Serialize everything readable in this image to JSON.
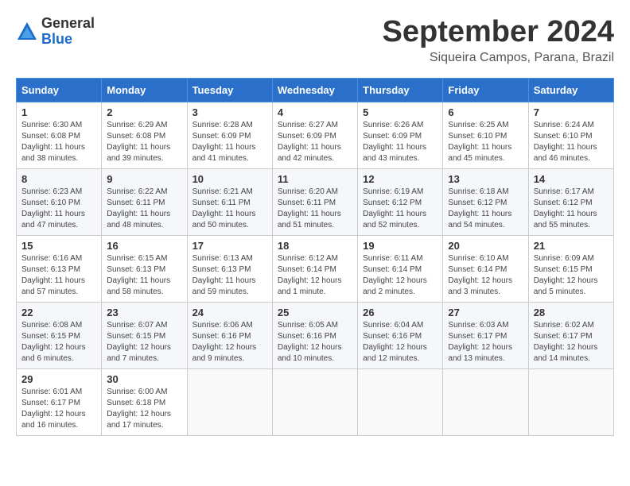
{
  "header": {
    "logo_general": "General",
    "logo_blue": "Blue",
    "month_title": "September 2024",
    "location": "Siqueira Campos, Parana, Brazil"
  },
  "days_of_week": [
    "Sunday",
    "Monday",
    "Tuesday",
    "Wednesday",
    "Thursday",
    "Friday",
    "Saturday"
  ],
  "weeks": [
    [
      {
        "day": "1",
        "sunrise": "6:30 AM",
        "sunset": "6:08 PM",
        "daylight": "11 hours and 38 minutes."
      },
      {
        "day": "2",
        "sunrise": "6:29 AM",
        "sunset": "6:08 PM",
        "daylight": "11 hours and 39 minutes."
      },
      {
        "day": "3",
        "sunrise": "6:28 AM",
        "sunset": "6:09 PM",
        "daylight": "11 hours and 41 minutes."
      },
      {
        "day": "4",
        "sunrise": "6:27 AM",
        "sunset": "6:09 PM",
        "daylight": "11 hours and 42 minutes."
      },
      {
        "day": "5",
        "sunrise": "6:26 AM",
        "sunset": "6:09 PM",
        "daylight": "11 hours and 43 minutes."
      },
      {
        "day": "6",
        "sunrise": "6:25 AM",
        "sunset": "6:10 PM",
        "daylight": "11 hours and 45 minutes."
      },
      {
        "day": "7",
        "sunrise": "6:24 AM",
        "sunset": "6:10 PM",
        "daylight": "11 hours and 46 minutes."
      }
    ],
    [
      {
        "day": "8",
        "sunrise": "6:23 AM",
        "sunset": "6:10 PM",
        "daylight": "11 hours and 47 minutes."
      },
      {
        "day": "9",
        "sunrise": "6:22 AM",
        "sunset": "6:11 PM",
        "daylight": "11 hours and 48 minutes."
      },
      {
        "day": "10",
        "sunrise": "6:21 AM",
        "sunset": "6:11 PM",
        "daylight": "11 hours and 50 minutes."
      },
      {
        "day": "11",
        "sunrise": "6:20 AM",
        "sunset": "6:11 PM",
        "daylight": "11 hours and 51 minutes."
      },
      {
        "day": "12",
        "sunrise": "6:19 AM",
        "sunset": "6:12 PM",
        "daylight": "11 hours and 52 minutes."
      },
      {
        "day": "13",
        "sunrise": "6:18 AM",
        "sunset": "6:12 PM",
        "daylight": "11 hours and 54 minutes."
      },
      {
        "day": "14",
        "sunrise": "6:17 AM",
        "sunset": "6:12 PM",
        "daylight": "11 hours and 55 minutes."
      }
    ],
    [
      {
        "day": "15",
        "sunrise": "6:16 AM",
        "sunset": "6:13 PM",
        "daylight": "11 hours and 57 minutes."
      },
      {
        "day": "16",
        "sunrise": "6:15 AM",
        "sunset": "6:13 PM",
        "daylight": "11 hours and 58 minutes."
      },
      {
        "day": "17",
        "sunrise": "6:13 AM",
        "sunset": "6:13 PM",
        "daylight": "11 hours and 59 minutes."
      },
      {
        "day": "18",
        "sunrise": "6:12 AM",
        "sunset": "6:14 PM",
        "daylight": "12 hours and 1 minute."
      },
      {
        "day": "19",
        "sunrise": "6:11 AM",
        "sunset": "6:14 PM",
        "daylight": "12 hours and 2 minutes."
      },
      {
        "day": "20",
        "sunrise": "6:10 AM",
        "sunset": "6:14 PM",
        "daylight": "12 hours and 3 minutes."
      },
      {
        "day": "21",
        "sunrise": "6:09 AM",
        "sunset": "6:15 PM",
        "daylight": "12 hours and 5 minutes."
      }
    ],
    [
      {
        "day": "22",
        "sunrise": "6:08 AM",
        "sunset": "6:15 PM",
        "daylight": "12 hours and 6 minutes."
      },
      {
        "day": "23",
        "sunrise": "6:07 AM",
        "sunset": "6:15 PM",
        "daylight": "12 hours and 7 minutes."
      },
      {
        "day": "24",
        "sunrise": "6:06 AM",
        "sunset": "6:16 PM",
        "daylight": "12 hours and 9 minutes."
      },
      {
        "day": "25",
        "sunrise": "6:05 AM",
        "sunset": "6:16 PM",
        "daylight": "12 hours and 10 minutes."
      },
      {
        "day": "26",
        "sunrise": "6:04 AM",
        "sunset": "6:16 PM",
        "daylight": "12 hours and 12 minutes."
      },
      {
        "day": "27",
        "sunrise": "6:03 AM",
        "sunset": "6:17 PM",
        "daylight": "12 hours and 13 minutes."
      },
      {
        "day": "28",
        "sunrise": "6:02 AM",
        "sunset": "6:17 PM",
        "daylight": "12 hours and 14 minutes."
      }
    ],
    [
      {
        "day": "29",
        "sunrise": "6:01 AM",
        "sunset": "6:17 PM",
        "daylight": "12 hours and 16 minutes."
      },
      {
        "day": "30",
        "sunrise": "6:00 AM",
        "sunset": "6:18 PM",
        "daylight": "12 hours and 17 minutes."
      },
      null,
      null,
      null,
      null,
      null
    ]
  ]
}
